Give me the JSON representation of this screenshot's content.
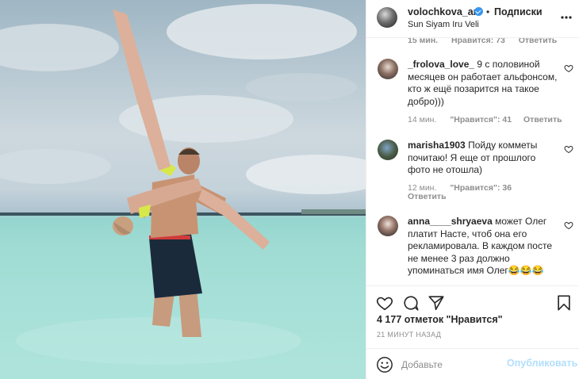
{
  "post": {
    "username": "volochkova_art",
    "separator": "•",
    "follow_status": "Подписки",
    "location": "Sun Siyam Iru Veli"
  },
  "photo": {
    "description_icon": "beach-photo"
  },
  "cut_row": {
    "time": "15 мин.",
    "likes": "Нравится: 73",
    "reply": "Ответить"
  },
  "comments": [
    {
      "username": "_frolova_love_",
      "text": "9 с половиной месяцев он работает альфонсом, кто ж ещё позарится на такое добро)))",
      "time": "14 мин.",
      "likes": "\"Нравится\": 41",
      "reply": "Ответить"
    },
    {
      "username": "marisha1903",
      "text": "Пойду комметы почитаю! Я еще от прошлого фото не отошла)",
      "time": "12 мин.",
      "likes": "\"Нравится\": 36",
      "reply": "Ответить"
    },
    {
      "username": "anna____shryaeva",
      "text": "может Олег платит Насте, чтоб она его рекламировала. В каждом посте не менее 3 раз должно упоминаться имя Олег😂😂😂"
    }
  ],
  "likes_text": "4 177 отметок \"Нравится\"",
  "time_ago": "21 МИНУТ НАЗАД",
  "add_comment": {
    "placeholder": "Добавьте",
    "publish_label": "Опубликовать"
  },
  "colors": {
    "accent": "#3897f0",
    "publish_disabled": "#b2dffc",
    "muted": "#8e8e8e",
    "text": "#262626"
  },
  "icons": [
    "more-icon",
    "heart-icon",
    "comment-icon",
    "share-icon",
    "bookmark-icon",
    "emoji-icon",
    "verified-icon"
  ]
}
